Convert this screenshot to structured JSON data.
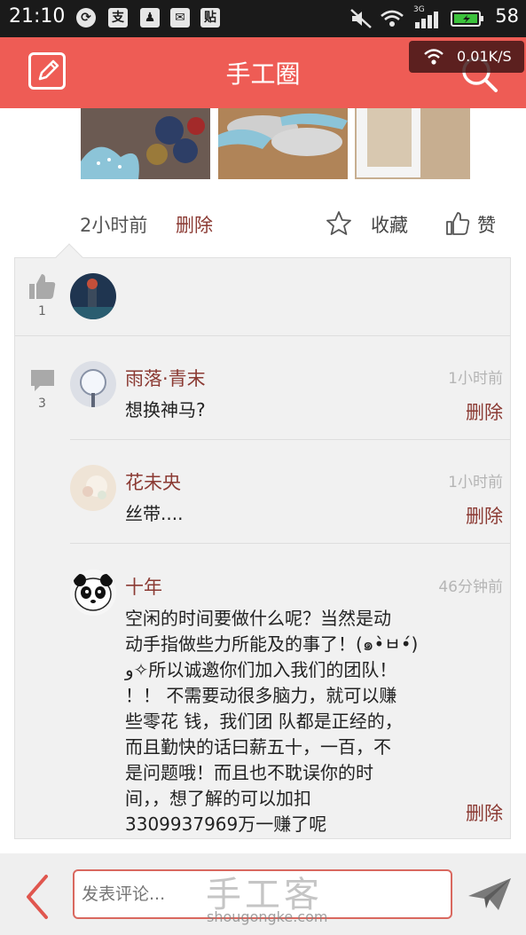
{
  "status_bar": {
    "time": "21:10",
    "notif_icons": [
      "sync-icon",
      "alipay-icon",
      "qq-icon",
      "mail-icon",
      "tieba-icon"
    ],
    "notif_glyphs": [
      "⟳",
      "支",
      "♟",
      "✉",
      "贴"
    ],
    "battery_level": "58",
    "network_label": "3G"
  },
  "header": {
    "title": "手工圈",
    "net_speed": "0.01K/S",
    "bg_color": "#ee5c55"
  },
  "post": {
    "time": "2小时前",
    "delete_label": "删除",
    "favorite_label": "收藏",
    "like_label": "赞"
  },
  "likes": {
    "count": "1"
  },
  "comments_summary": {
    "count": "3"
  },
  "comments": [
    {
      "name": "雨落·青末",
      "time": "1小时前",
      "text": "想换神马?",
      "delete_label": "删除"
    },
    {
      "name": "花未央",
      "time": "1小时前",
      "text": "丝带....",
      "delete_label": "删除"
    },
    {
      "name": "十年",
      "time": "46分钟前",
      "text_lines": [
        "空闲的时间要做什么呢？当然是动",
        "动手指做些力所能及的事了！(๑•̀ㅂ•́)",
        "و✧所以诚邀你们加入我们的团队！",
        "！！ 不需要动很多脑力，就可以赚",
        "些零花 钱，我们团 队都是正经的，",
        "而且勤快的话曰薪五十，一百，不",
        "是问题哦！而且也不耽误你的时",
        "间，，想了解的可以加扣",
        "3309937969万一赚了呢"
      ],
      "delete_label": "删除"
    }
  ],
  "bottom_bar": {
    "input_placeholder": "发表评论...",
    "watermark_name": "手工客",
    "watermark_url": "shougongke.com"
  }
}
